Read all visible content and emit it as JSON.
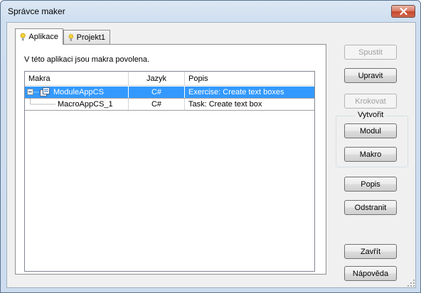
{
  "window": {
    "title": "Správce maker"
  },
  "tabs": [
    {
      "label": "Aplikace",
      "icon": "lightbulb-icon",
      "active": true
    },
    {
      "label": "Projekt1",
      "icon": "lightbulb-icon",
      "active": false
    }
  ],
  "panel": {
    "info": "V této aplikaci jsou makra povolena."
  },
  "grid": {
    "columns": [
      "Makra",
      "Jazyk",
      "Popis"
    ],
    "rows": [
      {
        "name": "ModuleAppCS",
        "language": "C#",
        "description": "Exercise: Create text boxes",
        "selected": true,
        "expanded": true,
        "level": 0
      },
      {
        "name": "MacroAppCS_1",
        "language": "C#",
        "description": "Task: Create text box",
        "selected": false,
        "level": 1
      }
    ]
  },
  "buttons": {
    "run": "Spustit",
    "edit": "Upravit",
    "step": "Krokovat",
    "create_group": "Vytvořit",
    "module": "Modul",
    "macro": "Makro",
    "description": "Popis",
    "remove": "Odstranit",
    "close": "Zavřít",
    "help": "Nápověda"
  },
  "colors": {
    "selection": "#3399ff",
    "close_button": "#c7472c"
  }
}
